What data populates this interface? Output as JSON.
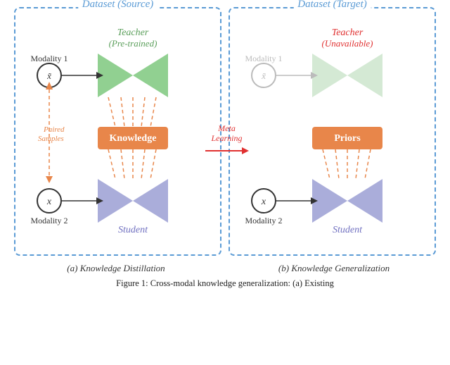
{
  "left_diagram": {
    "dataset_label": "Dataset (Source)",
    "teacher_label_line1": "Teacher",
    "teacher_label_line2": "(Pre-trained)",
    "knowledge_label": "Knowledge",
    "student_label": "Student",
    "modality1_label": "Modality 1",
    "modality2_label": "Modality 2",
    "modality1_symbol": "x̃",
    "modality2_symbol": "x",
    "paired_label": "Paired",
    "samples_label": "Samples",
    "caption": "(a) Knowledge Distillation"
  },
  "right_diagram": {
    "dataset_label": "Dataset (Target)",
    "teacher_label_line1": "Teacher",
    "teacher_label_line2": "(Unavailable)",
    "priors_label": "Priors",
    "student_label": "Student",
    "modality1_label": "Modality 1",
    "modality2_label": "Modality 2",
    "modality1_symbol": "x̃",
    "modality2_symbol": "x",
    "meta_label_line1": "Meta",
    "meta_label_line2": "Learning",
    "caption": "(b) Knowledge Generalization"
  },
  "figure_caption": "Figure 1: Cross-modal knowledge generalization: (a) Existing"
}
